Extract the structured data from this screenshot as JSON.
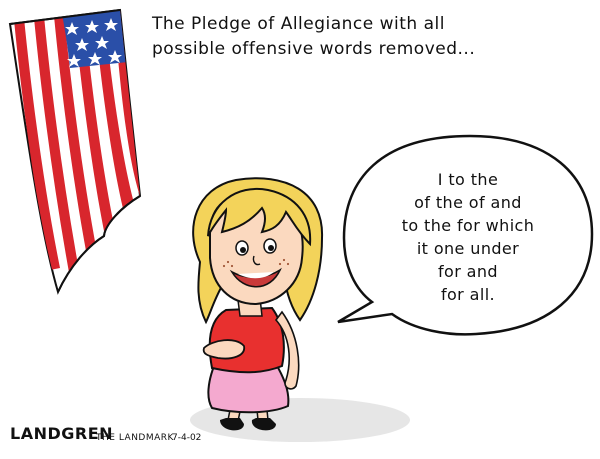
{
  "caption": {
    "line1": "The Pledge of Allegiance with all",
    "line2": "possible offensive words removed..."
  },
  "speech_bubble": {
    "lines": [
      "I to the",
      "of the of and",
      "to the for which",
      "it one under",
      "for and",
      "for all."
    ]
  },
  "signature": {
    "artist": "LANDGREN",
    "publication": "THE LANDMARK",
    "date": "7-4-02"
  },
  "colors": {
    "flag_red": "#d8262d",
    "flag_blue": "#2a4fa8",
    "hair": "#f3d35a",
    "shirt": "#e8302f",
    "skirt": "#f4a9cf",
    "skin": "#fbd9bf"
  }
}
